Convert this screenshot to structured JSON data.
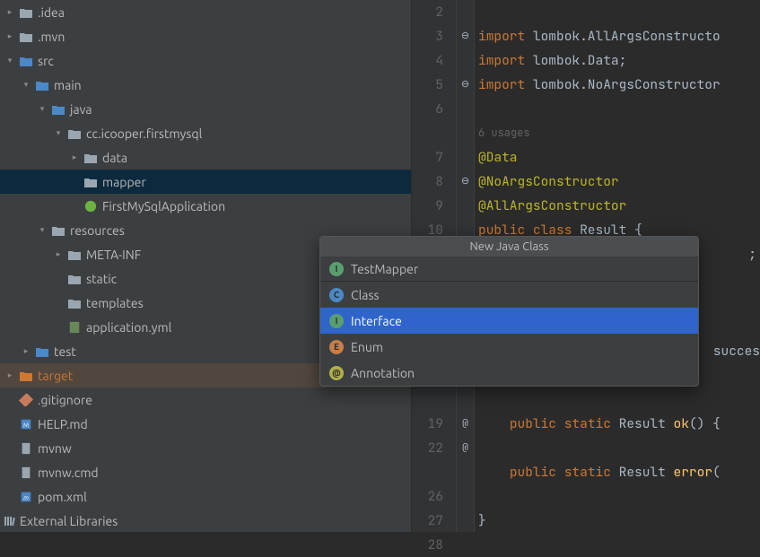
{
  "tree": [
    {
      "depth": 0,
      "chev": "right",
      "icon": "folder",
      "label": ".idea"
    },
    {
      "depth": 0,
      "chev": "right",
      "icon": "folder",
      "label": ".mvn"
    },
    {
      "depth": 0,
      "chev": "down",
      "icon": "folder-blue",
      "label": "src"
    },
    {
      "depth": 1,
      "chev": "down",
      "icon": "folder-blue",
      "label": "main"
    },
    {
      "depth": 2,
      "chev": "down",
      "icon": "folder-blue",
      "label": "java"
    },
    {
      "depth": 3,
      "chev": "down",
      "icon": "package",
      "label": "cc.icooper.firstmysql"
    },
    {
      "depth": 4,
      "chev": "right",
      "icon": "package",
      "label": "data"
    },
    {
      "depth": 4,
      "chev": "none",
      "icon": "package",
      "label": "mapper",
      "selected": true
    },
    {
      "depth": 4,
      "chev": "none",
      "icon": "spring",
      "label": "FirstMySqlApplication"
    },
    {
      "depth": 2,
      "chev": "down",
      "icon": "resources",
      "label": "resources"
    },
    {
      "depth": 3,
      "chev": "right",
      "icon": "folder",
      "label": "META-INF"
    },
    {
      "depth": 3,
      "chev": "none",
      "icon": "folder",
      "label": "static"
    },
    {
      "depth": 3,
      "chev": "none",
      "icon": "folder",
      "label": "templates"
    },
    {
      "depth": 3,
      "chev": "none",
      "icon": "yml",
      "label": "application.yml"
    },
    {
      "depth": 1,
      "chev": "right",
      "icon": "folder-blue",
      "label": "test"
    },
    {
      "depth": 0,
      "chev": "right",
      "icon": "folder-orange",
      "label": "target",
      "target": true
    },
    {
      "depth": 0,
      "chev": "none",
      "icon": "git",
      "label": ".gitignore"
    },
    {
      "depth": 0,
      "chev": "none",
      "icon": "md",
      "label": "HELP.md"
    },
    {
      "depth": 0,
      "chev": "none",
      "icon": "file",
      "label": "mvnw"
    },
    {
      "depth": 0,
      "chev": "none",
      "icon": "file",
      "label": "mvnw.cmd"
    },
    {
      "depth": 0,
      "chev": "none",
      "icon": "maven",
      "label": "pom.xml"
    }
  ],
  "ext_libs_label": "External Libraries",
  "gutter_lines": [
    "2",
    "3",
    "4",
    "5",
    "6",
    "",
    "7",
    "8",
    "9",
    "10",
    "",
    "",
    "",
    "",
    "",
    "",
    "",
    "19",
    "22",
    "",
    "26",
    "27",
    "28"
  ],
  "markers": {
    "1": "⊖",
    "3": "⊖",
    "7": "⊖",
    "17": "@",
    "18": "@"
  },
  "code": {
    "usage_hint": "6 usages",
    "l3": {
      "kw": "import",
      "rest": " lombok.AllArgsConstructo"
    },
    "l4": {
      "kw": "import",
      "rest": " lombok.Data;"
    },
    "l5": {
      "kw": "import",
      "rest": " lombok.NoArgsConstructor"
    },
    "l7": "@Data",
    "l8": "@NoArgsConstructor",
    "l9": "@AllArgsConstructor",
    "l10": {
      "kw1": "public",
      "kw2": "class",
      "cls": "Result",
      "brace": " {"
    },
    "l11_frag": ";",
    "l14_frag": " succes",
    "l19": {
      "kw1": "public",
      "kw2": "static",
      "type": "Result",
      "fn": "ok",
      "tail": "() {"
    },
    "l22": {
      "kw1": "public",
      "kw2": "static",
      "type": "Result",
      "fn": "error",
      "tail": "("
    },
    "l27": "}"
  },
  "popup": {
    "title": "New Java Class",
    "input_value": "TestMapper",
    "items": [
      {
        "badge": "C",
        "cls": "class",
        "label": "Class"
      },
      {
        "badge": "I",
        "cls": "iface",
        "label": "Interface",
        "selected": true
      },
      {
        "badge": "E",
        "cls": "enum",
        "label": "Enum"
      },
      {
        "badge": "@",
        "cls": "anno",
        "label": "Annotation"
      }
    ]
  }
}
